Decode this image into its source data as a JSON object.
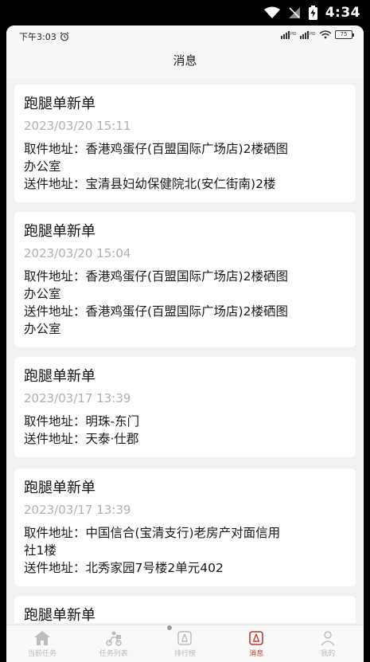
{
  "os_status": {
    "time": "4:34"
  },
  "inner_status": {
    "time": "下午3:03",
    "battery": "75"
  },
  "nav": {
    "title": "消息"
  },
  "messages": [
    {
      "title": "跑腿单新单",
      "time": "2023/03/20 15:11",
      "lines": [
        "取件地址：香港鸡蛋仔(百盟国际广场店)2楼硒图",
        "办公室",
        "送件地址：宝清县妇幼保健院北(安仁街南)2楼"
      ]
    },
    {
      "title": "跑腿单新单",
      "time": "2023/03/20 15:04",
      "lines": [
        "取件地址：香港鸡蛋仔(百盟国际广场店)2楼硒图",
        "办公室",
        "送件地址：香港鸡蛋仔(百盟国际广场店)2楼硒图",
        "办公室"
      ]
    },
    {
      "title": "跑腿单新单",
      "time": "2023/03/17 13:39",
      "lines": [
        "取件地址：明珠-东门",
        "送件地址：天泰·仕郡"
      ]
    },
    {
      "title": "跑腿单新单",
      "time": "2023/03/17 13:39",
      "lines": [
        "取件地址：中国信合(宝清支行)老房产对面信用",
        "社1楼",
        "送件地址：北秀家园7号楼2单元402"
      ]
    },
    {
      "title": "跑腿单新单",
      "time": "",
      "lines": []
    }
  ],
  "tabs": [
    {
      "label": "当前任务",
      "icon": "home-icon"
    },
    {
      "label": "任务列表",
      "icon": "courier-icon"
    },
    {
      "label": "排行榜",
      "icon": "ranking-icon"
    },
    {
      "label": "消息",
      "icon": "message-icon",
      "active": true
    },
    {
      "label": "我的",
      "icon": "user-icon"
    }
  ],
  "colors": {
    "accent": "#c0392b",
    "inactive": "#b8b8b8"
  }
}
